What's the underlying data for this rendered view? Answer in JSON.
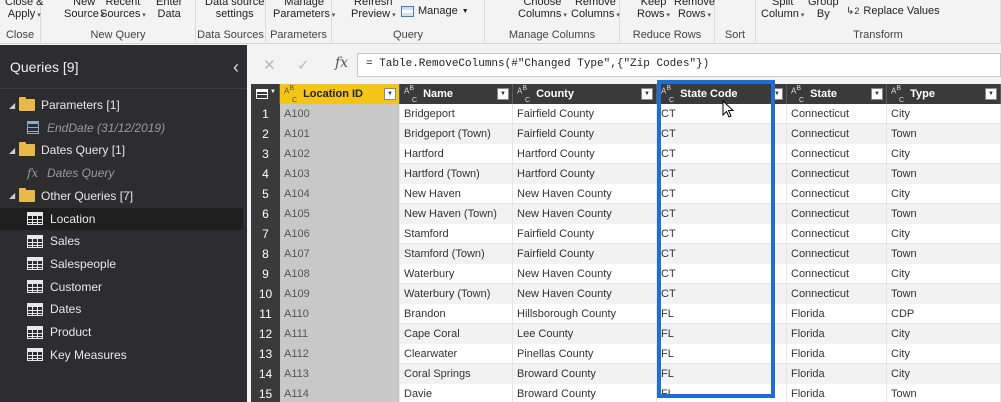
{
  "ribbon": {
    "groups": [
      {
        "label": "Close",
        "buttons": [
          {
            "l1": "Close &",
            "l2": "Apply"
          }
        ]
      },
      {
        "label": "New Query",
        "buttons": [
          {
            "l1": "New",
            "l2": "Source"
          },
          {
            "l1": "Recent",
            "l2": "Sources"
          },
          {
            "l1": "Enter",
            "l2": "Data"
          }
        ]
      },
      {
        "label": "Data Sources",
        "buttons": [
          {
            "l1": "Data source",
            "l2": "settings"
          }
        ]
      },
      {
        "label": "Parameters",
        "buttons": [
          {
            "l1": "Manage",
            "l2": "Parameters"
          }
        ]
      },
      {
        "label": "Query",
        "buttons": [
          {
            "l1": "Refresh",
            "l2": "Preview"
          }
        ],
        "inline": "Manage"
      },
      {
        "label": "Manage Columns",
        "buttons": [
          {
            "l1": "Choose",
            "l2": "Columns"
          },
          {
            "l1": "Remove",
            "l2": "Columns"
          }
        ]
      },
      {
        "label": "Reduce Rows",
        "buttons": [
          {
            "l1": "Keep",
            "l2": "Rows"
          },
          {
            "l1": "Remove",
            "l2": "Rows"
          }
        ]
      },
      {
        "label": "Sort",
        "buttons": []
      },
      {
        "label": "Transform",
        "buttons": [
          {
            "l1": "Split",
            "l2": "Column"
          },
          {
            "l1": "Group",
            "l2": "By"
          }
        ],
        "inline": "Replace Values",
        "inline_sub": "2"
      }
    ]
  },
  "queries": {
    "title": "Queries [9]",
    "collapse_glyph": "‹",
    "items": [
      {
        "kind": "folder",
        "label": "Parameters [1]",
        "indent": 0
      },
      {
        "kind": "param",
        "label": "EndDate (31/12/2019)",
        "indent": 1,
        "italic": true
      },
      {
        "kind": "folder",
        "label": "Dates Query [1]",
        "indent": 0
      },
      {
        "kind": "fx",
        "label": "Dates Query",
        "indent": 1,
        "italic": true
      },
      {
        "kind": "folder",
        "label": "Other Queries [7]",
        "indent": 0
      },
      {
        "kind": "table",
        "label": "Location",
        "indent": 1,
        "selected": true
      },
      {
        "kind": "table",
        "label": "Sales",
        "indent": 1
      },
      {
        "kind": "table",
        "label": "Salespeople",
        "indent": 1
      },
      {
        "kind": "table",
        "label": "Customer",
        "indent": 1
      },
      {
        "kind": "table",
        "label": "Dates",
        "indent": 1
      },
      {
        "kind": "table",
        "label": "Product",
        "indent": 1
      },
      {
        "kind": "table",
        "label": "Key Measures",
        "indent": 1
      }
    ]
  },
  "formula": {
    "fx": "fx",
    "text": "= Table.RemoveColumns(#\"Changed Type\",{\"Zip Codes\"})"
  },
  "grid": {
    "columns": [
      "Location ID",
      "Name",
      "County",
      "State Code",
      "State",
      "Type"
    ],
    "rows": [
      [
        "A100",
        "Bridgeport",
        "Fairfield County",
        "CT",
        "Connecticut",
        "City"
      ],
      [
        "A101",
        "Bridgeport (Town)",
        "Fairfield County",
        "CT",
        "Connecticut",
        "Town"
      ],
      [
        "A102",
        "Hartford",
        "Hartford County",
        "CT",
        "Connecticut",
        "City"
      ],
      [
        "A103",
        "Hartford (Town)",
        "Hartford County",
        "CT",
        "Connecticut",
        "Town"
      ],
      [
        "A104",
        "New Haven",
        "New Haven County",
        "CT",
        "Connecticut",
        "City"
      ],
      [
        "A105",
        "New Haven (Town)",
        "New Haven County",
        "CT",
        "Connecticut",
        "Town"
      ],
      [
        "A106",
        "Stamford",
        "Fairfield County",
        "CT",
        "Connecticut",
        "City"
      ],
      [
        "A107",
        "Stamford (Town)",
        "Fairfield County",
        "CT",
        "Connecticut",
        "Town"
      ],
      [
        "A108",
        "Waterbury",
        "New Haven County",
        "CT",
        "Connecticut",
        "City"
      ],
      [
        "A109",
        "Waterbury (Town)",
        "New Haven County",
        "CT",
        "Connecticut",
        "Town"
      ],
      [
        "A110",
        "Brandon",
        "Hillsborough County",
        "FL",
        "Florida",
        "CDP"
      ],
      [
        "A111",
        "Cape Coral",
        "Lee County",
        "FL",
        "Florida",
        "City"
      ],
      [
        "A112",
        "Clearwater",
        "Pinellas County",
        "FL",
        "Florida",
        "City"
      ],
      [
        "A113",
        "Coral Springs",
        "Broward County",
        "FL",
        "Florida",
        "City"
      ],
      [
        "A114",
        "Davie",
        "Broward County",
        "FL",
        "Florida",
        "Town"
      ]
    ]
  },
  "colors": {
    "accent_selected_header": "#f4c517",
    "annotation_box": "#1e6fd0",
    "queries_pane_bg": "#2d2d30"
  }
}
